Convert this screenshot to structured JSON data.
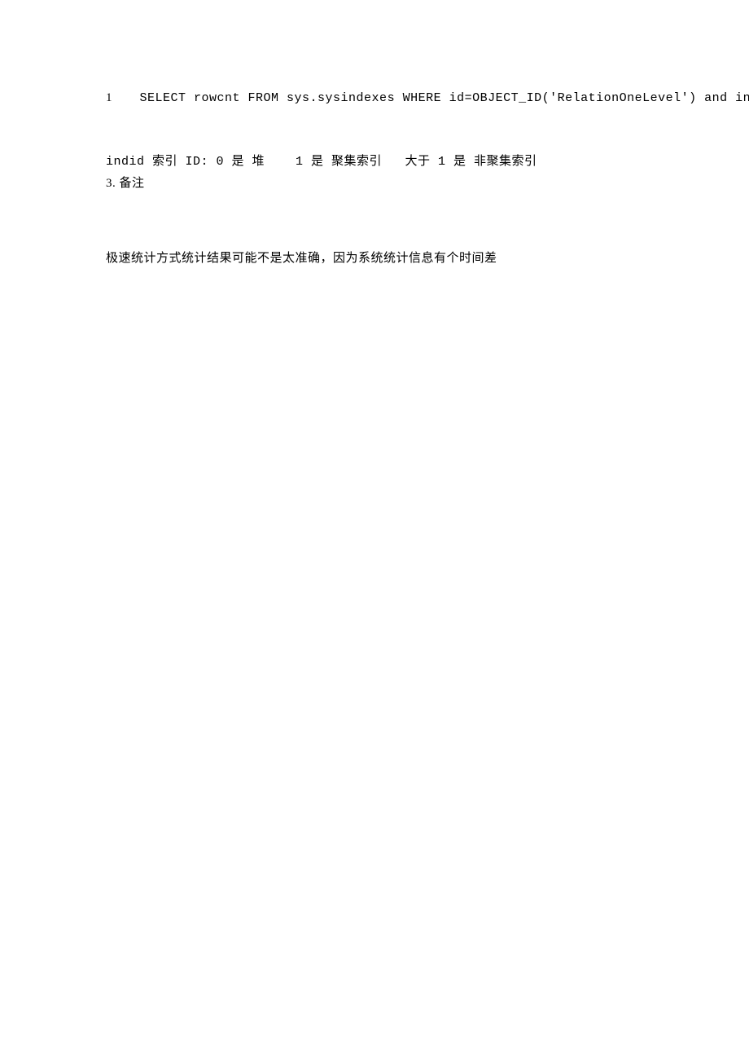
{
  "code": {
    "lineNumber": "1",
    "sql": "SELECT rowcnt FROM sys.sysindexes WHERE id=OBJECT_ID('RelationOneLevel') and ind"
  },
  "desc": "indid 索引 ID: 0 是 堆    1 是 聚集索引   大于 1 是 非聚集索引",
  "noteLabel": "3. 备注",
  "summary": "极速统计方式统计结果可能不是太准确，因为系统统计信息有个时间差"
}
